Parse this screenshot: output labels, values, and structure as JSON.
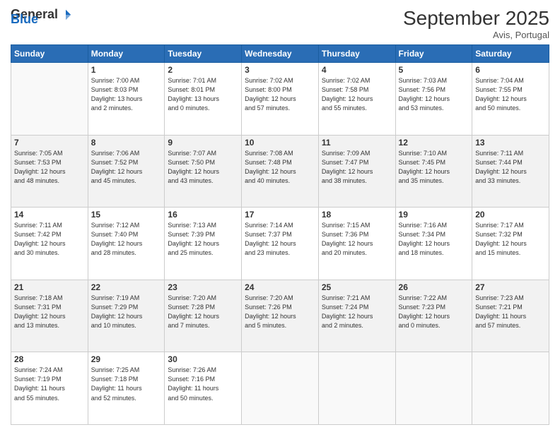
{
  "header": {
    "logo_general": "General",
    "logo_blue": "Blue",
    "month_title": "September 2025",
    "location": "Avis, Portugal"
  },
  "days_of_week": [
    "Sunday",
    "Monday",
    "Tuesday",
    "Wednesday",
    "Thursday",
    "Friday",
    "Saturday"
  ],
  "weeks": [
    [
      {
        "day": "",
        "info": ""
      },
      {
        "day": "1",
        "info": "Sunrise: 7:00 AM\nSunset: 8:03 PM\nDaylight: 13 hours\nand 2 minutes."
      },
      {
        "day": "2",
        "info": "Sunrise: 7:01 AM\nSunset: 8:01 PM\nDaylight: 13 hours\nand 0 minutes."
      },
      {
        "day": "3",
        "info": "Sunrise: 7:02 AM\nSunset: 8:00 PM\nDaylight: 12 hours\nand 57 minutes."
      },
      {
        "day": "4",
        "info": "Sunrise: 7:02 AM\nSunset: 7:58 PM\nDaylight: 12 hours\nand 55 minutes."
      },
      {
        "day": "5",
        "info": "Sunrise: 7:03 AM\nSunset: 7:56 PM\nDaylight: 12 hours\nand 53 minutes."
      },
      {
        "day": "6",
        "info": "Sunrise: 7:04 AM\nSunset: 7:55 PM\nDaylight: 12 hours\nand 50 minutes."
      }
    ],
    [
      {
        "day": "7",
        "info": "Sunrise: 7:05 AM\nSunset: 7:53 PM\nDaylight: 12 hours\nand 48 minutes."
      },
      {
        "day": "8",
        "info": "Sunrise: 7:06 AM\nSunset: 7:52 PM\nDaylight: 12 hours\nand 45 minutes."
      },
      {
        "day": "9",
        "info": "Sunrise: 7:07 AM\nSunset: 7:50 PM\nDaylight: 12 hours\nand 43 minutes."
      },
      {
        "day": "10",
        "info": "Sunrise: 7:08 AM\nSunset: 7:48 PM\nDaylight: 12 hours\nand 40 minutes."
      },
      {
        "day": "11",
        "info": "Sunrise: 7:09 AM\nSunset: 7:47 PM\nDaylight: 12 hours\nand 38 minutes."
      },
      {
        "day": "12",
        "info": "Sunrise: 7:10 AM\nSunset: 7:45 PM\nDaylight: 12 hours\nand 35 minutes."
      },
      {
        "day": "13",
        "info": "Sunrise: 7:11 AM\nSunset: 7:44 PM\nDaylight: 12 hours\nand 33 minutes."
      }
    ],
    [
      {
        "day": "14",
        "info": "Sunrise: 7:11 AM\nSunset: 7:42 PM\nDaylight: 12 hours\nand 30 minutes."
      },
      {
        "day": "15",
        "info": "Sunrise: 7:12 AM\nSunset: 7:40 PM\nDaylight: 12 hours\nand 28 minutes."
      },
      {
        "day": "16",
        "info": "Sunrise: 7:13 AM\nSunset: 7:39 PM\nDaylight: 12 hours\nand 25 minutes."
      },
      {
        "day": "17",
        "info": "Sunrise: 7:14 AM\nSunset: 7:37 PM\nDaylight: 12 hours\nand 23 minutes."
      },
      {
        "day": "18",
        "info": "Sunrise: 7:15 AM\nSunset: 7:36 PM\nDaylight: 12 hours\nand 20 minutes."
      },
      {
        "day": "19",
        "info": "Sunrise: 7:16 AM\nSunset: 7:34 PM\nDaylight: 12 hours\nand 18 minutes."
      },
      {
        "day": "20",
        "info": "Sunrise: 7:17 AM\nSunset: 7:32 PM\nDaylight: 12 hours\nand 15 minutes."
      }
    ],
    [
      {
        "day": "21",
        "info": "Sunrise: 7:18 AM\nSunset: 7:31 PM\nDaylight: 12 hours\nand 13 minutes."
      },
      {
        "day": "22",
        "info": "Sunrise: 7:19 AM\nSunset: 7:29 PM\nDaylight: 12 hours\nand 10 minutes."
      },
      {
        "day": "23",
        "info": "Sunrise: 7:20 AM\nSunset: 7:28 PM\nDaylight: 12 hours\nand 7 minutes."
      },
      {
        "day": "24",
        "info": "Sunrise: 7:20 AM\nSunset: 7:26 PM\nDaylight: 12 hours\nand 5 minutes."
      },
      {
        "day": "25",
        "info": "Sunrise: 7:21 AM\nSunset: 7:24 PM\nDaylight: 12 hours\nand 2 minutes."
      },
      {
        "day": "26",
        "info": "Sunrise: 7:22 AM\nSunset: 7:23 PM\nDaylight: 12 hours\nand 0 minutes."
      },
      {
        "day": "27",
        "info": "Sunrise: 7:23 AM\nSunset: 7:21 PM\nDaylight: 11 hours\nand 57 minutes."
      }
    ],
    [
      {
        "day": "28",
        "info": "Sunrise: 7:24 AM\nSunset: 7:19 PM\nDaylight: 11 hours\nand 55 minutes."
      },
      {
        "day": "29",
        "info": "Sunrise: 7:25 AM\nSunset: 7:18 PM\nDaylight: 11 hours\nand 52 minutes."
      },
      {
        "day": "30",
        "info": "Sunrise: 7:26 AM\nSunset: 7:16 PM\nDaylight: 11 hours\nand 50 minutes."
      },
      {
        "day": "",
        "info": ""
      },
      {
        "day": "",
        "info": ""
      },
      {
        "day": "",
        "info": ""
      },
      {
        "day": "",
        "info": ""
      }
    ]
  ]
}
